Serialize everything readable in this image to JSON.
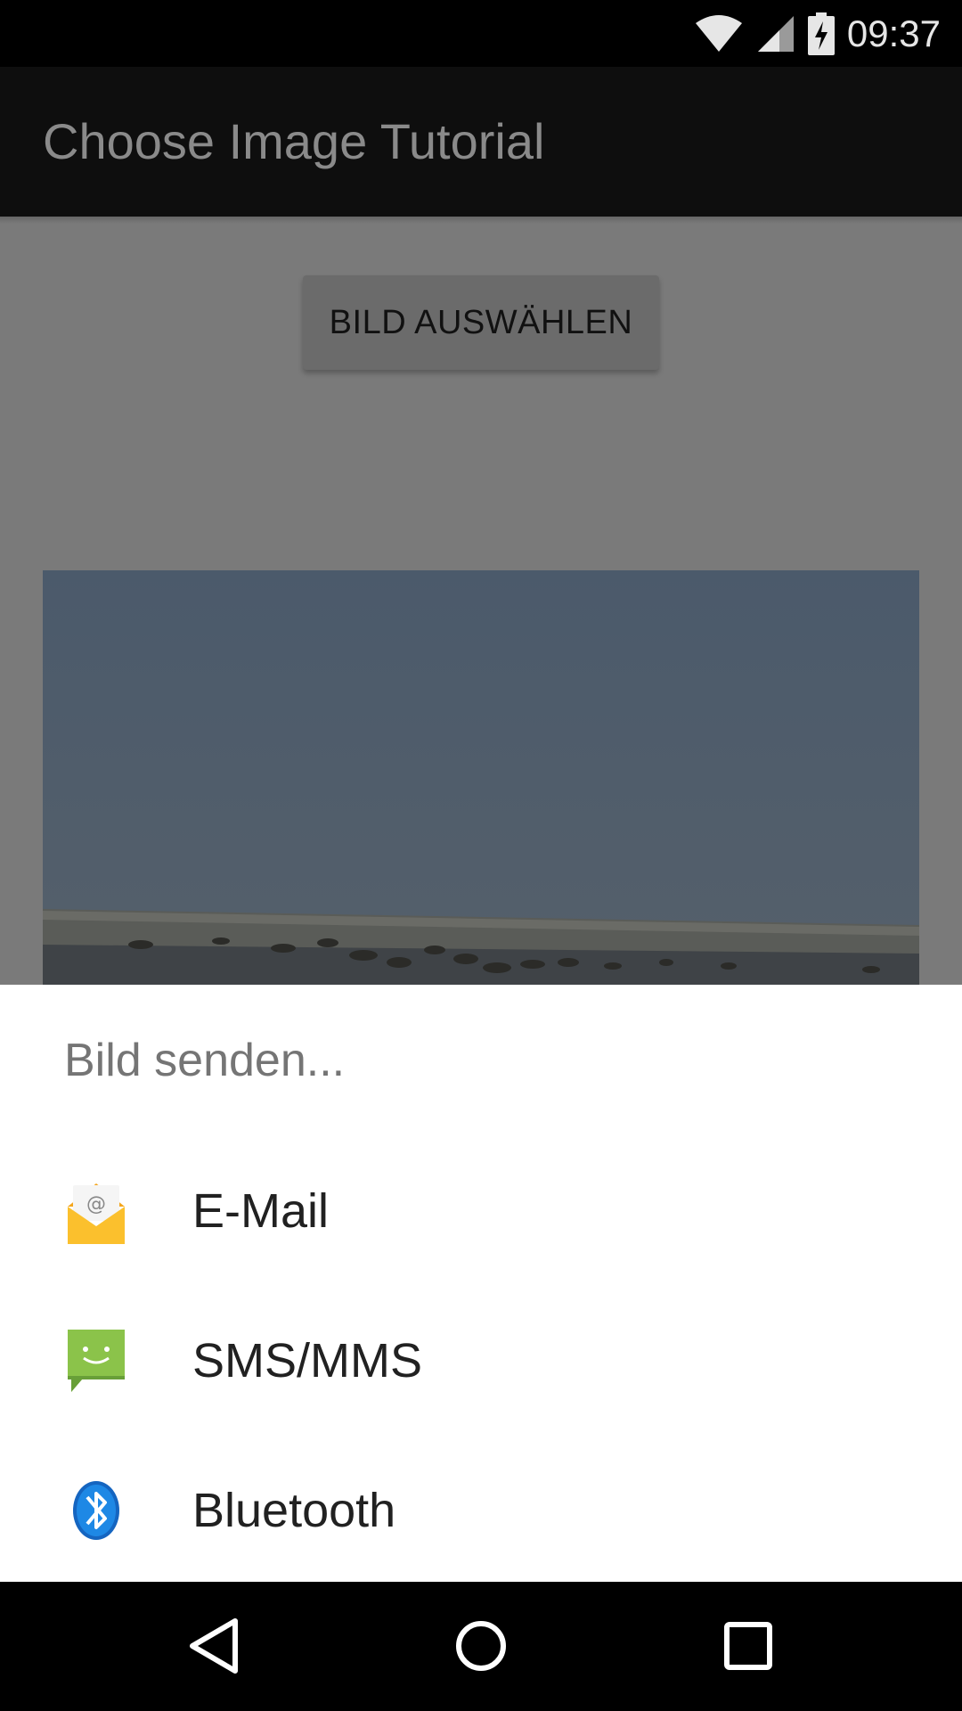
{
  "status_bar": {
    "time": "09:37",
    "icons": [
      "wifi-icon",
      "signal-icon",
      "battery-charging-icon"
    ]
  },
  "app_bar": {
    "title": "Choose Image Tutorial"
  },
  "main": {
    "pick_button_label": "BILD AUSWÄHLEN"
  },
  "share_sheet": {
    "title": "Bild senden...",
    "items": [
      {
        "label": "E-Mail",
        "icon": "email-icon"
      },
      {
        "label": "SMS/MMS",
        "icon": "messaging-icon"
      },
      {
        "label": "Bluetooth",
        "icon": "bluetooth-icon"
      }
    ]
  },
  "nav_bar": {
    "buttons": [
      "back-icon",
      "home-icon",
      "recents-icon"
    ]
  }
}
